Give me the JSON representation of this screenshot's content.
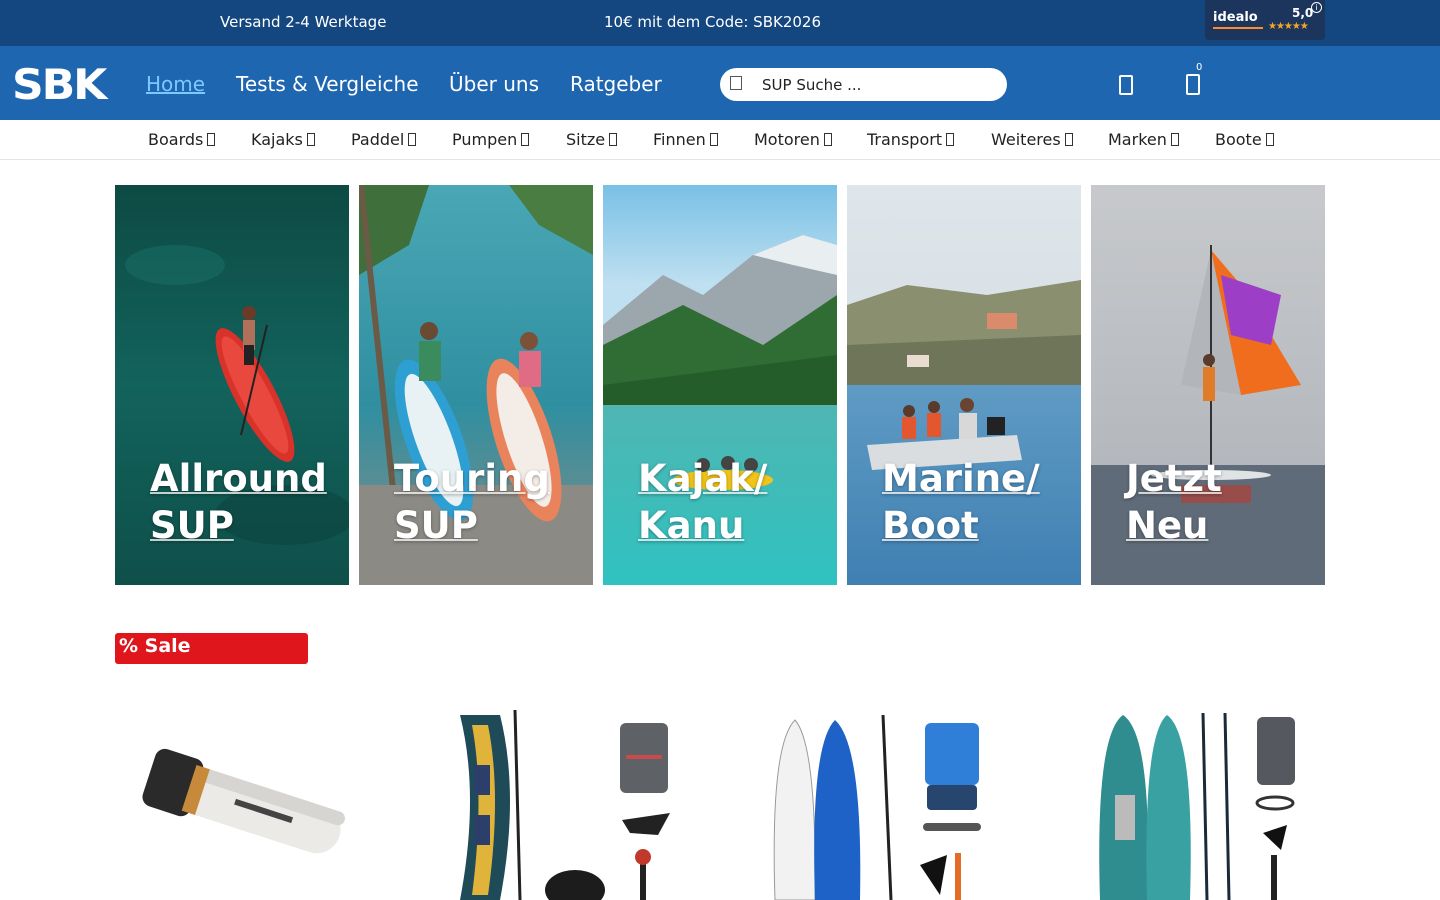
{
  "topbar": {
    "shipping": "Versand 2-4 Werktage",
    "promo": "10€ mit dem Code: SBK2026",
    "idealo": {
      "logo": "idealo",
      "score": "5,0",
      "stars": "★★★★★",
      "info": "i"
    }
  },
  "header": {
    "brand": "SBK",
    "nav": [
      "Home",
      "Tests & Vergleiche",
      "Über uns",
      "Ratgeber"
    ],
    "search_placeholder": "SUP Suche ...",
    "cart_count": "0"
  },
  "categories": [
    "Boards",
    "Kajaks",
    "Paddel",
    "Pumpen",
    "Sitze",
    "Finnen",
    "Motoren",
    "Transport",
    "Weiteres",
    "Marken",
    "Boote"
  ],
  "tiles": [
    {
      "line1": "Allround",
      "line2": "SUP"
    },
    {
      "line1": "Touring",
      "line2": "SUP"
    },
    {
      "line1": "Kajak/",
      "line2": "Kanu"
    },
    {
      "line1": "Marine/",
      "line2": "Boot"
    },
    {
      "line1": "Jetzt",
      "line2": "Neu"
    }
  ],
  "sale": {
    "label": "% Sale"
  },
  "colors": {
    "topbar": "#14467f",
    "header": "#1f66b1",
    "sale": "#e0161d",
    "active_nav": "#7fc7ff"
  }
}
